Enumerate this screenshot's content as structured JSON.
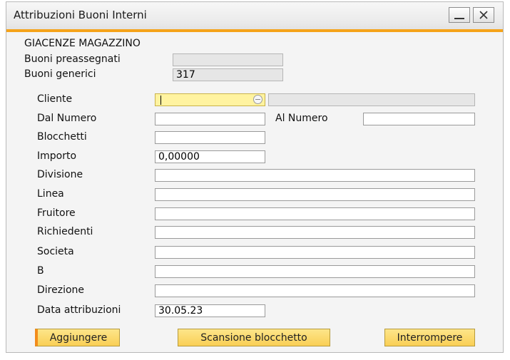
{
  "window": {
    "title": "Attribuzioni Buoni Interni"
  },
  "section": {
    "heading": "GIACENZE MAGAZZINO"
  },
  "stock": {
    "preassigned_label": "Buoni preassegnati",
    "preassigned_value": "",
    "generic_label": "Buoni generici",
    "generic_value": "317"
  },
  "form": {
    "cliente_label": "Cliente",
    "cliente_value": "",
    "cliente_name_value": "",
    "dal_numero_label": "Dal Numero",
    "dal_numero_value": "",
    "al_numero_label": "Al Numero",
    "al_numero_value": "",
    "blocchetti_label": "Blocchetti",
    "blocchetti_value": "",
    "importo_label": "Importo",
    "importo_value": "0,00000",
    "divisione_label": "Divisione",
    "divisione_value": "",
    "linea_label": "Linea",
    "linea_value": "",
    "fruitore_label": "Fruitore",
    "fruitore_value": "",
    "richiedenti_label": "Richiedenti",
    "richiedenti_value": "",
    "societa_label": "Societa",
    "societa_value": "",
    "b_label": "B",
    "b_value": "",
    "direzione_label": "Direzione",
    "direzione_value": "",
    "data_label": "Data attribuzioni",
    "data_value": "30.05.23"
  },
  "buttons": {
    "add": "Aggiungere",
    "scan": "Scansione blocchetto",
    "cancel": "Interrompere"
  },
  "colors": {
    "accent": "#f5a31a",
    "button_fill": "#f9cf55",
    "active_field": "#fff3a0"
  },
  "icons": {
    "minimize": "minimize-icon",
    "close": "close-icon",
    "link": "link-arrow-icon"
  }
}
